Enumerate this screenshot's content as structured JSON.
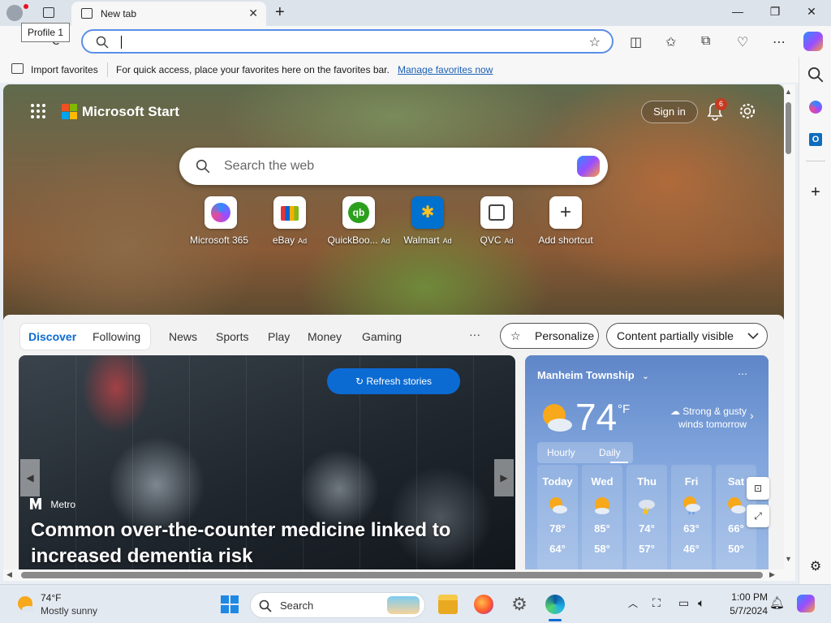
{
  "browser": {
    "tab_title": "New tab",
    "profile_tooltip": "Profile 1",
    "omnibox_value": "",
    "favorites_bar": {
      "import_label": "Import favorites",
      "message": "For quick access, place your favorites here on the favorites bar.",
      "manage_link": "Manage favorites now"
    }
  },
  "page": {
    "brand": "Microsoft Start",
    "sign_in": "Sign in",
    "notification_count": "6",
    "search_placeholder": "Search the web",
    "tiles": [
      {
        "label": "Microsoft 365",
        "ad": ""
      },
      {
        "label": "eBay",
        "ad": "Ad"
      },
      {
        "label": "QuickBoo...",
        "ad": "Ad"
      },
      {
        "label": "Walmart",
        "ad": "Ad"
      },
      {
        "label": "QVC",
        "ad": "Ad"
      },
      {
        "label": "Add shortcut",
        "ad": ""
      }
    ],
    "feed_tabs": [
      "Discover",
      "Following"
    ],
    "feed_nav": [
      "News",
      "Sports",
      "Play",
      "Money",
      "Gaming"
    ],
    "more": "···",
    "personalize": "Personalize",
    "content_visibility": "Content partially visible",
    "refresh": "Refresh stories",
    "story": {
      "source": "Metro",
      "headline": "Common over-the-counter medicine linked to increased dementia risk"
    },
    "weather": {
      "location": "Manheim Township",
      "temp": "74",
      "unit": "°F",
      "note": "Strong & gusty winds tomorrow",
      "tabs": [
        "Hourly",
        "Daily"
      ],
      "days": [
        {
          "name": "Today",
          "hi": "78°",
          "lo": "64°"
        },
        {
          "name": "Wed",
          "hi": "85°",
          "lo": "58°"
        },
        {
          "name": "Thu",
          "hi": "74°",
          "lo": "57°"
        },
        {
          "name": "Fri",
          "hi": "63°",
          "lo": "46°"
        },
        {
          "name": "Sat",
          "hi": "66°",
          "lo": "50°"
        }
      ]
    }
  },
  "taskbar": {
    "weather_temp": "74°F",
    "weather_desc": "Mostly sunny",
    "search": "Search",
    "time": "1:00 PM",
    "date": "5/7/2024"
  },
  "colors": {
    "accent": "#0b6bd3",
    "ms_red": "#f25022",
    "ms_green": "#7fba00",
    "ms_blue": "#00a4ef",
    "ms_yellow": "#ffb900"
  }
}
